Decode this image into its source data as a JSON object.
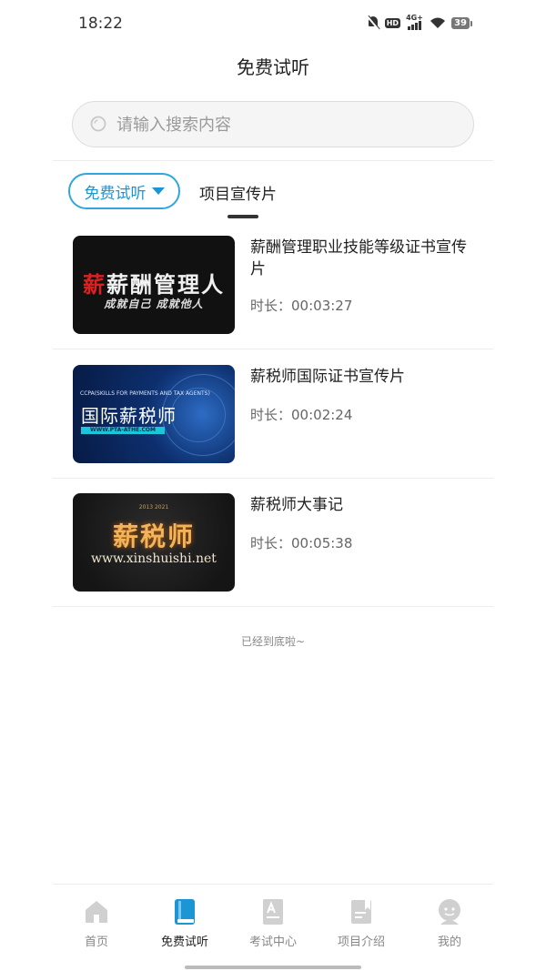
{
  "status_bar": {
    "time": "18:22",
    "hd_label": "HD",
    "network_label": "4G+",
    "battery": "39",
    "icons": [
      "mute-icon",
      "hd-icon",
      "signal-icon",
      "wifi-icon",
      "battery-icon"
    ]
  },
  "header": {
    "title": "免费试听"
  },
  "search": {
    "placeholder": "请输入搜索内容",
    "value": ""
  },
  "tabs": [
    {
      "label": "免费试听",
      "active": true
    },
    {
      "label": "项目宣传片",
      "active": false
    }
  ],
  "accent_color": "#1b95d3",
  "videos": [
    {
      "title": "薪酬管理职业技能等级证书宣传片",
      "duration_label": "时长：",
      "duration": "00:03:27",
      "thumb": {
        "red_char": "薪",
        "main": "薪酬管理人",
        "sub": "成就自己 成就他人"
      }
    },
    {
      "title": "薪税师国际证书宣传片",
      "duration_label": "时长：",
      "duration": "00:02:24",
      "thumb": {
        "top": "CCPA(SKILLS FOR PAYMENTS AND TAX AGENTS)",
        "main": "国际薪税师",
        "url": "WWW.PTA-ATHE.COM"
      }
    },
    {
      "title": "薪税师大事记",
      "duration_label": "时长：",
      "duration": "00:05:38",
      "thumb": {
        "year": "2013 2021",
        "main": "薪税师",
        "url": "www.xinshuishi.net"
      }
    }
  ],
  "end_text": "已经到底啦~",
  "bottom_nav": [
    {
      "label": "首页",
      "icon": "home-icon",
      "active": false
    },
    {
      "label": "免费试听",
      "icon": "book-icon",
      "active": true
    },
    {
      "label": "考试中心",
      "icon": "exam-icon",
      "active": false
    },
    {
      "label": "项目介绍",
      "icon": "bookmark-icon",
      "active": false
    },
    {
      "label": "我的",
      "icon": "profile-icon",
      "active": false
    }
  ]
}
